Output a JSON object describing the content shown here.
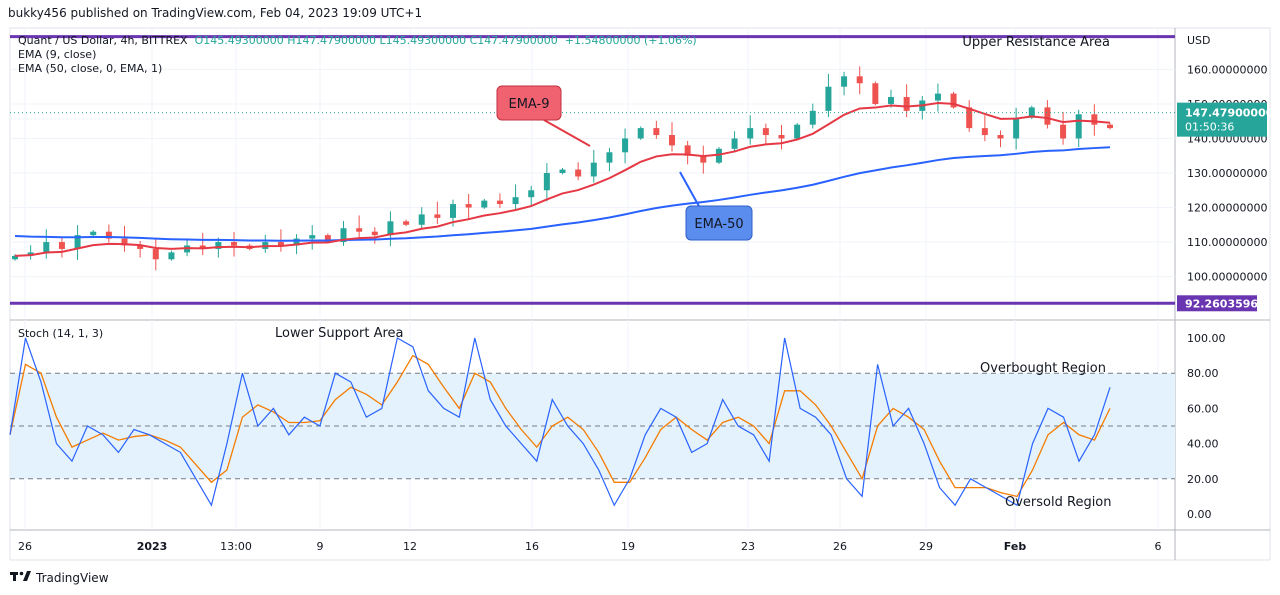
{
  "header": {
    "published_line": "bukky456 published on TradingView.com, Feb 04, 2023 19:09 UTC+1"
  },
  "legend": {
    "symbol_line": "Quant / US Dollar, 4h, BITTREX",
    "ohlc": "O145.49300000  H147.47900000  L145.49300000  C147.47900000",
    "change": "+1.54800000 (+1.06%)",
    "ema9": "EMA (9, close)",
    "ema50": "EMA (50, close, 0, EMA, 1)"
  },
  "price_axis": {
    "currency": "USD",
    "ticks": [
      "160.00000000",
      "150.00000000",
      "140.00000000",
      "130.00000000",
      "120.00000000",
      "110.00000000",
      "100.00000000"
    ],
    "price_label": "147.47900000",
    "countdown": "01:50:36",
    "support_label": "92.26035965"
  },
  "stoch_axis": {
    "ticks": [
      "100.00",
      "80.00",
      "60.00",
      "40.00",
      "20.00",
      "0.00"
    ],
    "indicator_label": "Stoch (14, 1, 3)"
  },
  "time_axis": {
    "ticks": [
      "26",
      "2023",
      "13:00",
      "9",
      "12",
      "16",
      "19",
      "23",
      "26",
      "29",
      "Feb",
      "6"
    ]
  },
  "annotations": {
    "upper_resistance": "Upper Resistance Area",
    "lower_support": "Lower Support Area",
    "ema9_callout": "EMA-9",
    "ema50_callout": "EMA-50",
    "overbought": "Overbought Region",
    "oversold": "Oversold Region"
  },
  "footer": {
    "brand": "TradingView"
  },
  "colors": {
    "up": "#26a69a",
    "down": "#ef5350",
    "ema9": "#e53945",
    "ema50": "#2962ff",
    "level": "#6a35b0",
    "stoch_k": "#2962ff",
    "stoch_d": "#f57c00",
    "band": "#e3f2fd",
    "callout_red": "#f06270",
    "callout_blue": "#5b8def"
  },
  "chart_data": [
    {
      "type": "candlestick",
      "title": "Quant / US Dollar, 4h, BITTREX",
      "ylabel": "USD",
      "ylim": [
        88,
        172
      ],
      "levels": {
        "upper_resistance": 169.5,
        "lower_support": 92.26035965
      },
      "last": {
        "open": 145.493,
        "high": 147.479,
        "low": 145.493,
        "close": 147.479
      },
      "x_ticks": [
        "26",
        "2023",
        "13:00",
        "9",
        "12",
        "16",
        "19",
        "23",
        "26",
        "29",
        "Feb",
        "6"
      ],
      "closes": [
        106,
        107,
        110,
        108,
        112,
        113,
        111,
        109,
        108,
        105,
        107,
        109,
        108,
        110,
        109,
        108,
        110,
        109,
        111,
        112,
        110,
        114,
        113,
        112,
        116,
        115,
        118,
        117,
        121,
        120,
        122,
        121,
        123,
        125,
        130,
        131,
        129,
        133,
        136,
        140,
        143,
        141,
        138,
        135,
        133,
        137,
        140,
        143,
        141,
        140,
        144,
        148,
        155,
        158,
        156,
        150,
        152,
        148,
        151,
        153,
        149,
        143,
        141,
        140,
        146,
        149,
        144,
        140,
        147,
        144,
        143
      ],
      "ema9_end": 145.0,
      "ema50_end": 146.5
    },
    {
      "type": "line",
      "title": "Stoch (14, 1, 3)",
      "ylim": [
        0,
        100
      ],
      "bands": {
        "overbought": 80,
        "mid": 50,
        "oversold": 20
      },
      "series": [
        {
          "name": "%K",
          "values": [
            45,
            100,
            75,
            40,
            30,
            50,
            45,
            35,
            48,
            45,
            40,
            35,
            20,
            5,
            40,
            80,
            50,
            60,
            45,
            55,
            50,
            80,
            75,
            55,
            60,
            100,
            95,
            70,
            60,
            55,
            100,
            65,
            50,
            40,
            30,
            65,
            50,
            40,
            25,
            5,
            20,
            45,
            60,
            55,
            35,
            40,
            65,
            50,
            45,
            30,
            100,
            60,
            55,
            45,
            20,
            10,
            85,
            50,
            60,
            40,
            15,
            5,
            20,
            15,
            10,
            5,
            40,
            60,
            55,
            30,
            45,
            72
          ]
        },
        {
          "name": "%D",
          "values": [
            45,
            85,
            80,
            55,
            38,
            42,
            46,
            42,
            44,
            45,
            42,
            38,
            28,
            18,
            25,
            55,
            62,
            58,
            52,
            52,
            53,
            65,
            72,
            68,
            62,
            75,
            90,
            85,
            72,
            60,
            80,
            75,
            60,
            48,
            38,
            50,
            55,
            48,
            35,
            18,
            18,
            32,
            48,
            55,
            48,
            42,
            52,
            55,
            50,
            40,
            70,
            70,
            62,
            50,
            35,
            20,
            50,
            60,
            55,
            48,
            30,
            15,
            15,
            15,
            12,
            10,
            25,
            45,
            52,
            45,
            42,
            60
          ]
        }
      ]
    }
  ]
}
